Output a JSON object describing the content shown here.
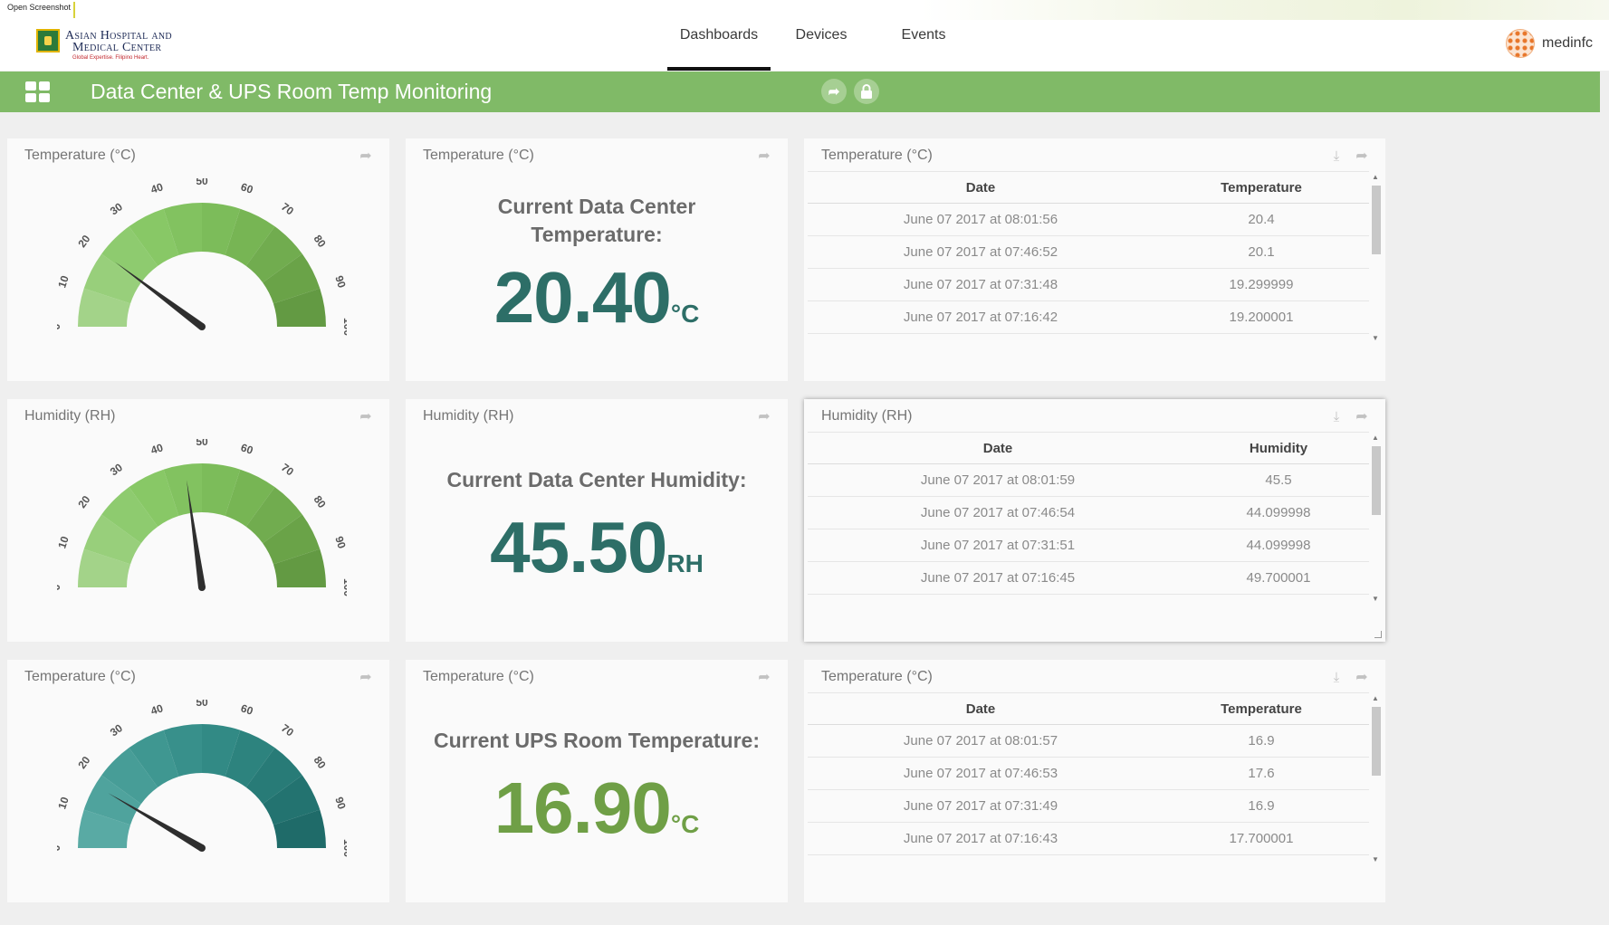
{
  "overlay_label": "Open Screenshot",
  "logo": {
    "line1": "Asian Hospital and",
    "line2": "Medical Center",
    "tagline": "Global Expertise. Filipino Heart."
  },
  "nav": {
    "dashboards": "Dashboards",
    "devices": "Devices",
    "events": "Events"
  },
  "user": {
    "name": "medinfc"
  },
  "dashboard": {
    "title": "Data Center & UPS Room Temp Monitoring"
  },
  "colors": {
    "accent": "#80ba67",
    "teal": "#2d6e67",
    "green_value": "#6f9f46"
  },
  "gauge_ticks": [
    "0",
    "10",
    "20",
    "30",
    "40",
    "50",
    "60",
    "70",
    "80",
    "90",
    "100"
  ],
  "rows": [
    {
      "gauge": {
        "title": "Temperature (°C)",
        "value": 20.4,
        "min": 0,
        "max": 100,
        "palette": "green"
      },
      "value_card": {
        "title": "Temperature (°C)",
        "label": "Current Data Center Temperature:",
        "value": "20.40",
        "unit": "°C",
        "color": "#2d6e67"
      },
      "table": {
        "title": "Temperature (°C)",
        "headers": [
          "Date",
          "Temperature"
        ],
        "rows": [
          [
            "June 07 2017 at 08:01:56",
            "20.4"
          ],
          [
            "June 07 2017 at 07:46:52",
            "20.1"
          ],
          [
            "June 07 2017 at 07:31:48",
            "19.299999"
          ],
          [
            "June 07 2017 at 07:16:42",
            "19.200001"
          ]
        ]
      }
    },
    {
      "gauge": {
        "title": "Humidity (RH)",
        "value": 45.5,
        "min": 0,
        "max": 100,
        "palette": "green"
      },
      "value_card": {
        "title": "Humidity (RH)",
        "label": "Current Data Center Humidity:",
        "value": "45.50",
        "unit": "RH",
        "color": "#2d6e67"
      },
      "table": {
        "title": "Humidity (RH)",
        "headers": [
          "Date",
          "Humidity"
        ],
        "rows": [
          [
            "June 07 2017 at 08:01:59",
            "45.5"
          ],
          [
            "June 07 2017 at 07:46:54",
            "44.099998"
          ],
          [
            "June 07 2017 at 07:31:51",
            "44.099998"
          ],
          [
            "June 07 2017 at 07:16:45",
            "49.700001"
          ]
        ]
      }
    },
    {
      "gauge": {
        "title": "Temperature (°C)",
        "value": 16.9,
        "min": 0,
        "max": 100,
        "palette": "teal"
      },
      "value_card": {
        "title": "Temperature (°C)",
        "label": "Current UPS Room Temperature:",
        "value": "16.90",
        "unit": "°C",
        "color": "#6f9f46"
      },
      "table": {
        "title": "Temperature (°C)",
        "headers": [
          "Date",
          "Temperature"
        ],
        "rows": [
          [
            "June 07 2017 at 08:01:57",
            "16.9"
          ],
          [
            "June 07 2017 at 07:46:53",
            "17.6"
          ],
          [
            "June 07 2017 at 07:31:49",
            "16.9"
          ],
          [
            "June 07 2017 at 07:16:43",
            "17.700001"
          ]
        ]
      }
    }
  ]
}
